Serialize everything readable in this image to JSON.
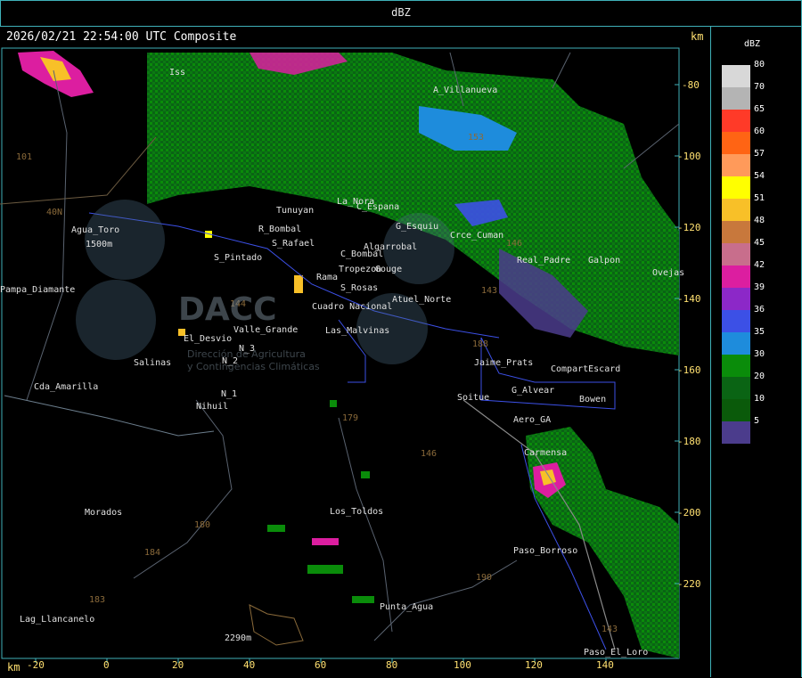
{
  "header": {
    "title": "dBZ"
  },
  "map": {
    "timestamp": "2026/02/21 22:54:00 UTC Composite",
    "unit_top": "km",
    "unit_bottom": "km",
    "x_ticks": [
      "-20",
      "0",
      "20",
      "40",
      "60",
      "80",
      "100",
      "120",
      "140"
    ],
    "y_ticks": [
      "-80",
      "-100",
      "-120",
      "-140",
      "-160",
      "-180",
      "-200",
      "-220"
    ],
    "places": [
      "A_Villanueva",
      "Iss",
      "Tunuyan",
      "La_Nora",
      "C_Espana",
      "G_Esquiu",
      "Crce_Cuman",
      "S_Pintado",
      "R_Bombal",
      "S_Rafael",
      "Algarrobal",
      "C_Bombal",
      "Tropezon",
      "Gouge",
      "Rama",
      "S_Rosas",
      "Atuel_Norte",
      "Cuadro Nacional",
      "Real_Padre",
      "Galpon",
      "Ovejas",
      "Jaime_Prats",
      "Soitue",
      "G_Alvear",
      "CompartEscard",
      "Bowen",
      "Aero_GA",
      "Carmensa",
      "Valle_Grande",
      "El_Desvio",
      "Las_Malvinas",
      "Salinas",
      "N_2",
      "N_3",
      "N_1",
      "Nihuil",
      "Cda_Amarilla",
      "Agua_Toro",
      "Pampa_Diamante",
      "Morados",
      "Los_Toldos",
      "Lag_Llancanelo",
      "Punta_Agua",
      "Paso_Borroso",
      "Paso_El_Loro",
      "2290m",
      "1500m"
    ],
    "route_numbers": [
      "101",
      "40N",
      "144",
      "143",
      "179",
      "188",
      "180",
      "184",
      "183",
      "153",
      "190",
      "146",
      "146",
      "143"
    ],
    "watermark": [
      "DACC",
      "Dirección de Agricultura",
      "y Contingencias Climáticas"
    ]
  },
  "legend": {
    "title": "dBZ",
    "levels": [
      {
        "label": "80",
        "color": "#d8d8d8"
      },
      {
        "label": "70",
        "color": "#b4b4b4"
      },
      {
        "label": "65",
        "color": "#ff3a28"
      },
      {
        "label": "60",
        "color": "#ff6414"
      },
      {
        "label": "57",
        "color": "#ff9a5a"
      },
      {
        "label": "54",
        "color": "#ffff00"
      },
      {
        "label": "51",
        "color": "#f8c028"
      },
      {
        "label": "48",
        "color": "#c8783c"
      },
      {
        "label": "45",
        "color": "#c86e8c"
      },
      {
        "label": "42",
        "color": "#dc1ea0"
      },
      {
        "label": "39",
        "color": "#8c28c8"
      },
      {
        "label": "36",
        "color": "#3c50e6"
      },
      {
        "label": "35",
        "color": "#1e8cdc"
      },
      {
        "label": "30",
        "color": "#0a8c0a"
      },
      {
        "label": "20",
        "color": "#0a6414"
      },
      {
        "label": "10",
        "color": "#0a5a0a"
      },
      {
        "label": "5",
        "color": "#4b3c8c"
      }
    ]
  }
}
